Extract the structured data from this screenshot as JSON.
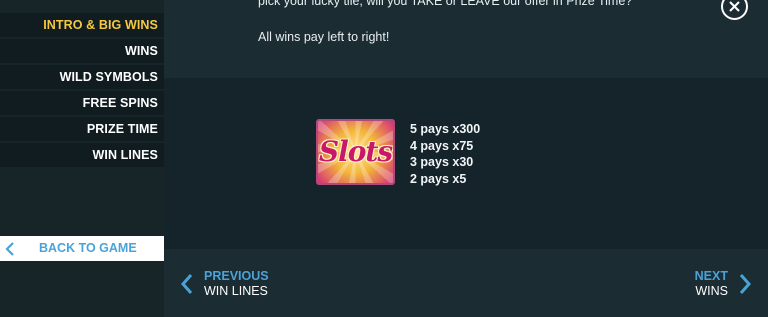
{
  "sidebar": {
    "items": [
      {
        "label": "INTRO & BIG WINS",
        "active": true
      },
      {
        "label": "WINS",
        "active": false
      },
      {
        "label": "WILD SYMBOLS",
        "active": false
      },
      {
        "label": "FREE SPINS",
        "active": false
      },
      {
        "label": "PRIZE TIME",
        "active": false
      },
      {
        "label": "WIN LINES",
        "active": false
      }
    ],
    "back_label": "BACK TO GAME",
    "back_icon": "chevron-left-icon"
  },
  "content": {
    "intro_line": "pick your lucky tile, will you TAKE or LEAVE our offer in Prize Time?",
    "note": "All wins pay left to right!",
    "symbol": {
      "word": "Slots",
      "icon": "slots-symbol"
    },
    "pays": [
      "5 pays x300",
      "4 pays x75",
      "3 pays x30",
      "2 pays x5"
    ]
  },
  "close_icon": "close-icon",
  "nav": {
    "prev_title": "PREVIOUS",
    "prev_sub": "WIN LINES",
    "next_title": "NEXT",
    "next_sub": "WINS"
  },
  "colors": {
    "active": "#f5c842",
    "accent": "#4aa3d8",
    "background": "#18272d"
  }
}
